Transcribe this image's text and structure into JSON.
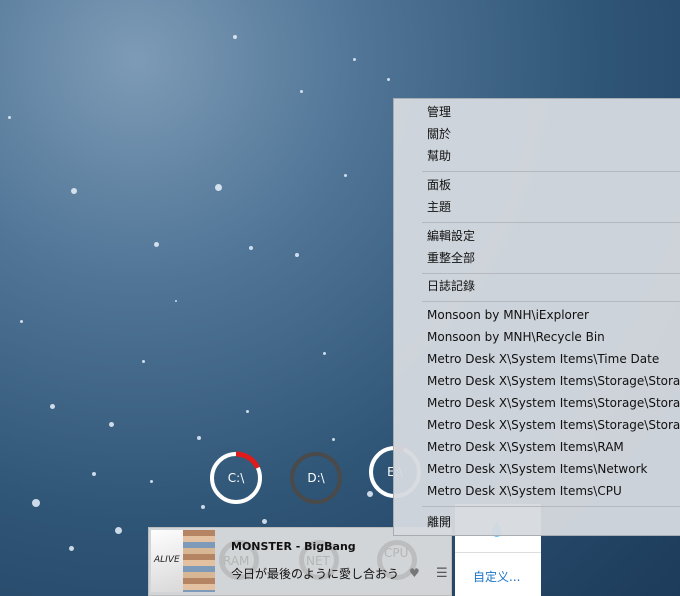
{
  "gauges": [
    {
      "label": "C:\\",
      "fill": 0.18,
      "color": "#e01b1b"
    },
    {
      "label": "D:\\",
      "fill": 0.0,
      "color": "#3a3a3a"
    },
    {
      "label": "E:\\",
      "fill": 0.06,
      "color": "#9b1b2e"
    }
  ],
  "player": {
    "album_text": "ALIVE",
    "title": "MONSTER",
    "artist": "BigBang",
    "title_line": "MONSTER - BigBang",
    "lyric": "今日が最後のように愛し合おう",
    "ghost_labels": {
      "ram": "RAM",
      "net": "NET",
      "cpu": "CPU"
    },
    "heart_icon": "heart-icon",
    "list_icon": "list-icon"
  },
  "panel": {
    "custom_label": "自定义..."
  },
  "menu": {
    "items": [
      "管理",
      "關於",
      "幫助",
      "面板",
      "主題",
      "編輯設定",
      "重整全部",
      "日誌記錄",
      "Monsoon by MNH\\iExplorer",
      "Monsoon by MNH\\Recycle Bin",
      "Metro Desk X\\System Items\\Time  Date",
      "Metro Desk X\\System Items\\Storage\\Storage",
      "Metro Desk X\\System Items\\Storage\\Storage",
      "Metro Desk X\\System Items\\Storage\\Storage",
      "Metro Desk X\\System Items\\RAM",
      "Metro Desk X\\System Items\\Network",
      "Metro Desk X\\System Items\\CPU",
      "離開"
    ]
  }
}
